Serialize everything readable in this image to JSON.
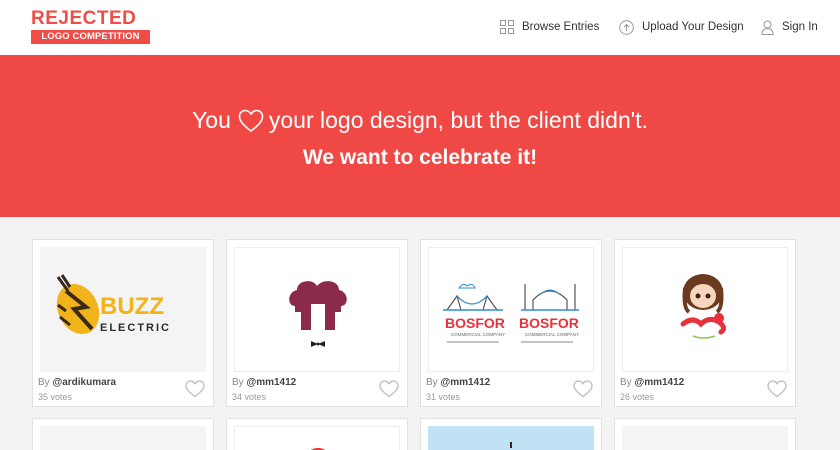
{
  "brand": {
    "line1": "REJECTED",
    "line2": "LOGO COMPETITION"
  },
  "nav": [
    {
      "label": "Browse Entries",
      "icon": "grid-icon"
    },
    {
      "label": "Upload Your Design",
      "icon": "upload-icon"
    },
    {
      "label": "Sign In",
      "icon": "user-icon"
    }
  ],
  "hero": {
    "line1_before": "You",
    "line1_after": "your logo design, but the client didn't.",
    "line2": "We want to celebrate it!"
  },
  "colors": {
    "accent": "#f04945",
    "logo_yellow": "#f2b31b",
    "logo_maroon": "#8c2a4b"
  },
  "entries": [
    {
      "by": "By",
      "author": "@ardikumara",
      "votes": "35 votes",
      "logo_text": [
        "BUZZ",
        "ELECTRIC"
      ]
    },
    {
      "by": "By",
      "author": "@mm1412",
      "votes": "34 votes"
    },
    {
      "by": "By",
      "author": "@mm1412",
      "votes": "31 votes",
      "logo_text": [
        "BOSFOR",
        "COMMERCIAL COMPANY",
        "BOSFOR",
        "COMMERCIAL COMPANY"
      ]
    },
    {
      "by": "By",
      "author": "@mm1412",
      "votes": "26 votes"
    }
  ]
}
